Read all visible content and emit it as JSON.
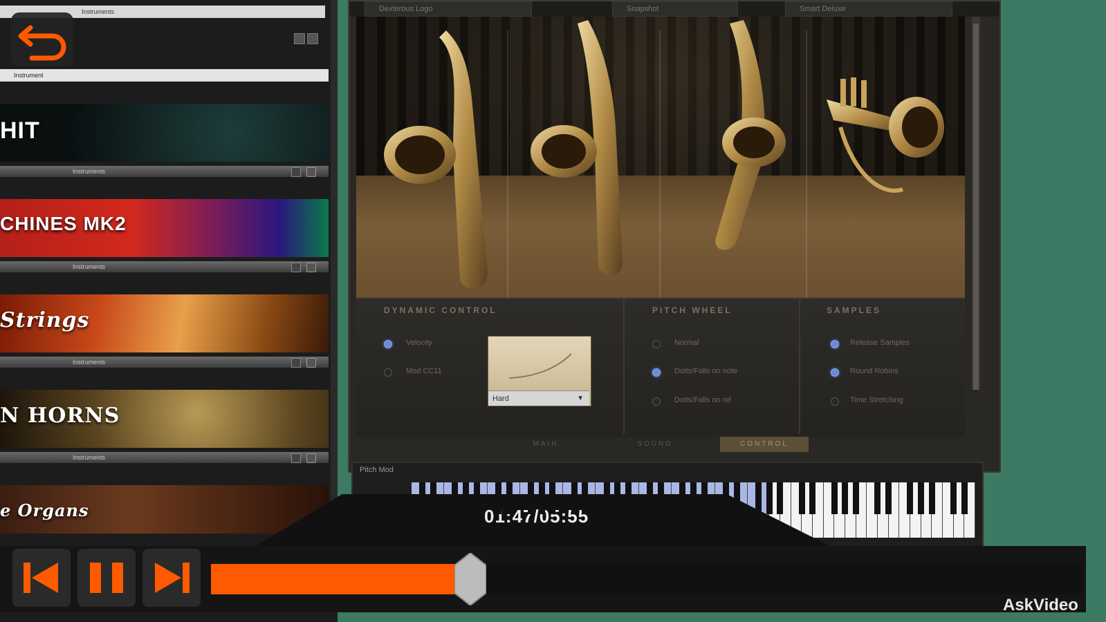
{
  "sidebar": {
    "top_bar_label": "Instruments",
    "second_bar_label": "Instrument",
    "cards": [
      {
        "banner_text": "HIT",
        "footer_label": "Instruments"
      },
      {
        "banner_text": "CHINES MK2",
        "footer_label": "Instruments"
      },
      {
        "banner_text": "Strings",
        "footer_label": "Instruments"
      },
      {
        "banner_text": "N HORNS",
        "footer_label": "Instruments"
      },
      {
        "banner_text": "e Organs",
        "footer_label": ""
      }
    ]
  },
  "instrument": {
    "top_buttons": [
      "Dexterous Logo",
      "Snapshot",
      "Smart Deluxe"
    ],
    "dynamic_control": {
      "title": "DYNAMIC CONTROL",
      "options": [
        {
          "label": "Velocity",
          "selected": true
        },
        {
          "label": "Mod CC11",
          "selected": false
        }
      ],
      "curve_value": "Hard"
    },
    "pitch_wheel": {
      "title": "PITCH WHEEL",
      "options": [
        {
          "label": "Normal",
          "selected": false
        },
        {
          "label": "Doits/Falls on note",
          "selected": true
        },
        {
          "label": "Doits/Falls on rel",
          "selected": false
        }
      ]
    },
    "samples": {
      "title": "SAMPLES",
      "options": [
        {
          "label": "Release Samples",
          "selected": true
        },
        {
          "label": "Round Robins",
          "selected": true
        },
        {
          "label": "Time Stretching",
          "selected": false
        }
      ]
    },
    "tabs": [
      {
        "label": "MAIN",
        "active": false
      },
      {
        "label": "SOUND",
        "active": false
      },
      {
        "label": "CONTROL",
        "active": true
      }
    ]
  },
  "keyboard": {
    "label": "Pitch Mod"
  },
  "player": {
    "timecode": "01:47/05:55",
    "progress": 0.298,
    "colors": {
      "accent": "#ff5a00"
    }
  },
  "watermark": "AskVideo"
}
